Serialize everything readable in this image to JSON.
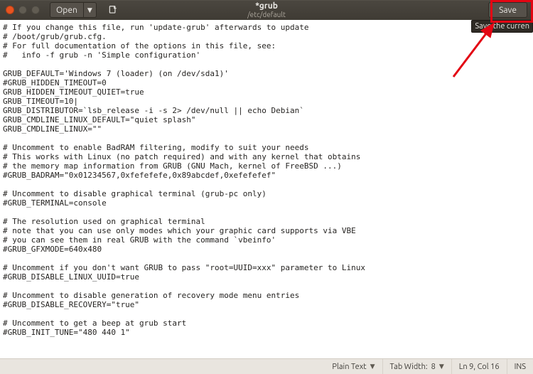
{
  "window": {
    "title": "*grub",
    "subtitle": "/etc/default",
    "open_label": "Open",
    "save_label": "Save",
    "save_tooltip": "Save the curren"
  },
  "editor": {
    "content": "# If you change this file, run 'update-grub' afterwards to update\n# /boot/grub/grub.cfg.\n# For full documentation of the options in this file, see:\n#   info -f grub -n 'Simple configuration'\n\nGRUB_DEFAULT='Windows 7 (loader) (on /dev/sda1)'\n#GRUB_HIDDEN_TIMEOUT=0\nGRUB_HIDDEN_TIMEOUT_QUIET=true\nGRUB_TIMEOUT=10|\nGRUB_DISTRIBUTOR=`lsb_release -i -s 2> /dev/null || echo Debian`\nGRUB_CMDLINE_LINUX_DEFAULT=\"quiet splash\"\nGRUB_CMDLINE_LINUX=\"\"\n\n# Uncomment to enable BadRAM filtering, modify to suit your needs\n# This works with Linux (no patch required) and with any kernel that obtains\n# the memory map information from GRUB (GNU Mach, kernel of FreeBSD ...)\n#GRUB_BADRAM=\"0x01234567,0xfefefefe,0x89abcdef,0xefefefef\"\n\n# Uncomment to disable graphical terminal (grub-pc only)\n#GRUB_TERMINAL=console\n\n# The resolution used on graphical terminal\n# note that you can use only modes which your graphic card supports via VBE\n# you can see them in real GRUB with the command `vbeinfo'\n#GRUB_GFXMODE=640x480\n\n# Uncomment if you don't want GRUB to pass \"root=UUID=xxx\" parameter to Linux\n#GRUB_DISABLE_LINUX_UUID=true\n\n# Uncomment to disable generation of recovery mode menu entries\n#GRUB_DISABLE_RECOVERY=\"true\"\n\n# Uncomment to get a beep at grub start\n#GRUB_INIT_TUNE=\"480 440 1\""
  },
  "statusbar": {
    "syntax": "Plain Text",
    "tabwidth_label": "Tab Width:",
    "tabwidth_value": "8",
    "cursor": "Ln 9, Col 16",
    "insert_mode": "INS"
  }
}
